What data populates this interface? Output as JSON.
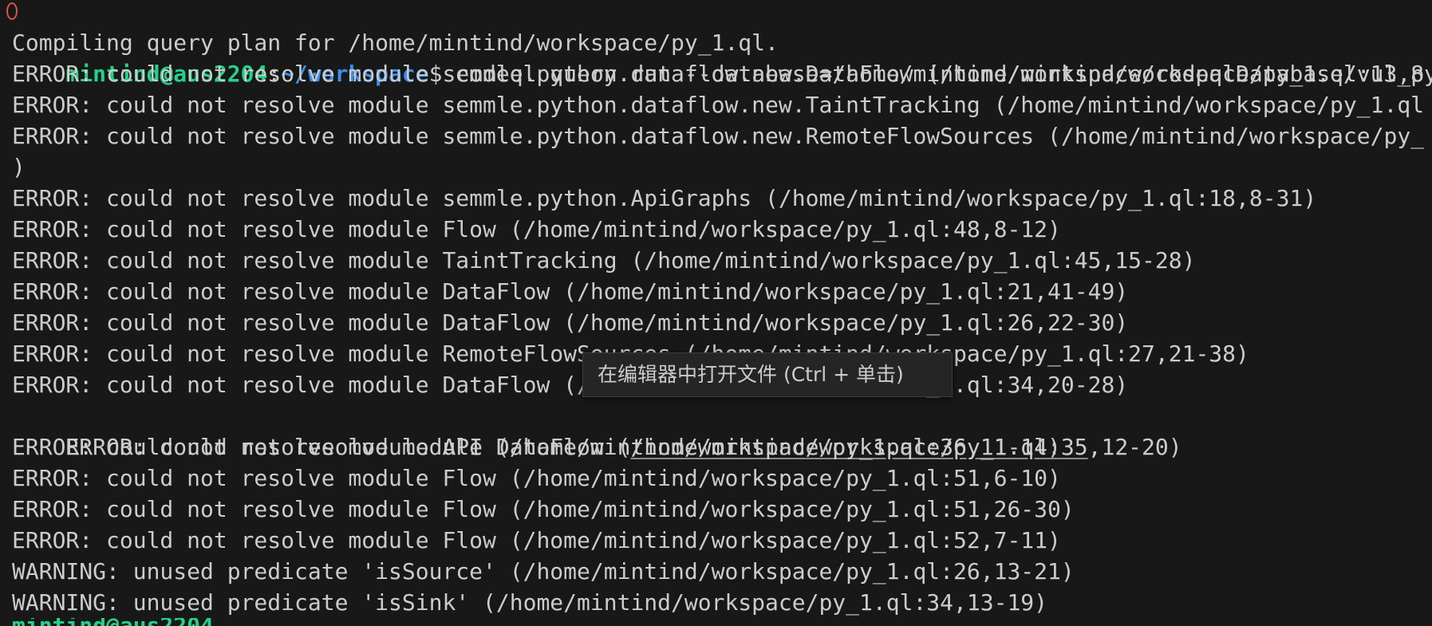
{
  "prompt": {
    "user_host": "mintind@aus2204",
    "separator": ":",
    "path": "~/workspace",
    "symbol": "$",
    "command": " codeql query run --database=/home/mintind/workspace/codeqlDatabase/vul_py py"
  },
  "output_lines": [
    "Compiling query plan for /home/mintind/workspace/py_1.ql.",
    "ERROR: could not resolve module semmle.python.dataflow.new.DataFlow (/home/mintind/workspace/py_1.ql:13,8",
    "ERROR: could not resolve module semmle.python.dataflow.new.TaintTracking (/home/mintind/workspace/py_1.ql",
    "ERROR: could not resolve module semmle.python.dataflow.new.RemoteFlowSources (/home/mintind/workspace/py_",
    ")",
    "ERROR: could not resolve module semmle.python.ApiGraphs (/home/mintind/workspace/py_1.ql:18,8-31)",
    "ERROR: could not resolve module Flow (/home/mintind/workspace/py_1.ql:48,8-12)",
    "ERROR: could not resolve module TaintTracking (/home/mintind/workspace/py_1.ql:45,15-28)",
    "ERROR: could not resolve module DataFlow (/home/mintind/workspace/py_1.ql:21,41-49)",
    "ERROR: could not resolve module DataFlow (/home/mintind/workspace/py_1.ql:26,22-30)",
    "ERROR: could not resolve module RemoteFlowSources (/home/mintind/workspace/py_1.ql:27,21-38)",
    "ERROR: could not resolve module DataFlow (/home/mintind/workspace/py_1.ql:34,20-28)",
    "ERROR: could not resolve module DataFlow (/home/mintind/workspace/py_1.ql:35,12-20)",
    "ERROR: could not resolve module API (/home/mintind/workspace/py_1.ql:36,11-14)",
    "ERROR: could not resolve module Flow (/home/mintind/workspace/py_1.ql:51,6-10)",
    "ERROR: could not resolve module Flow (/home/mintind/workspace/py_1.ql:51,26-30)",
    "ERROR: could not resolve module Flow (/home/mintind/workspace/py_1.ql:52,7-11)",
    "WARNING: unused predicate 'isSource' (/home/mintind/workspace/py_1.ql:26,13-21)",
    "WARNING: unused predicate 'isSink' (/home/mintind/workspace/py_1.ql:34,13-19)"
  ],
  "hovered_line": {
    "prefix": "ERROR: could not resolve module DataFlow (",
    "link": "/home/mintind/workspace/py_1.ql:35",
    "suffix": ",12-20)"
  },
  "tooltip": {
    "text": "在编辑器中打开文件 (Ctrl + 单击)"
  },
  "colors": {
    "background": "#181818",
    "text": "#cccccc",
    "user_host": "#23d18b",
    "path": "#3b8eea",
    "marker": "#e05252"
  }
}
